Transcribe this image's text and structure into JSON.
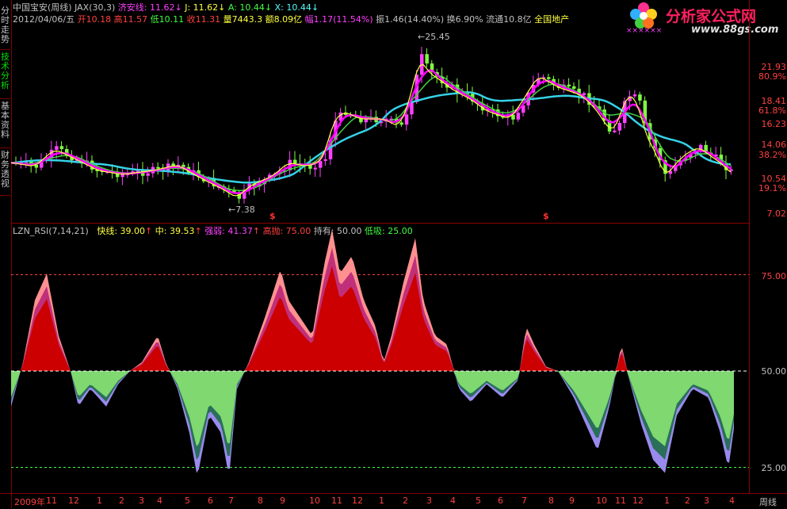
{
  "header": {
    "line1": {
      "stock": "中国宝安(周线)",
      "indicator": "JAX(30,3)",
      "jax_label": "济安线: 11.62",
      "j_label": "J: 11.62",
      "a_label": "A: 10.44",
      "x_label": "X: 10.44"
    },
    "line2": {
      "date": "2012/04/06/五",
      "open": "开10.18",
      "high": "高11.57",
      "low": "低10.11",
      "close": "收11.31",
      "volume": "量7443.3",
      "amount": "额8.09亿",
      "change": "幅1.17(11.54%)",
      "amplitude": "振1.46(14.40%)",
      "turnover": "换6.90%",
      "float": "流通10.8亿",
      "sector": "全国地产"
    }
  },
  "sidebar": {
    "items": [
      {
        "label": "分时走势"
      },
      {
        "label": "技术分析"
      },
      {
        "label": "基本资料"
      },
      {
        "label": "财务透视"
      }
    ]
  },
  "logo": {
    "title": "分析家公式网",
    "url": "www.88gs.com",
    "marks": "××××××"
  },
  "upper_axis": [
    "21.93",
    "80.9%",
    "18.41",
    "61.8%",
    "16.23",
    "14.06",
    "38.2%",
    "10.54",
    "19.1%",
    "7.02"
  ],
  "price_annotations": {
    "high": "25.45",
    "low": "7.38",
    "flag": "$"
  },
  "lower_header": {
    "name": "LZN_RSI(7,14,21)",
    "fast": "快线: 39.00",
    "mid": "中: 39.53",
    "strength": "强弱: 41.37",
    "high_sell": "高抛: 75.00",
    "hold": "持有: 50.00",
    "low_buy": "低吸: 25.00"
  },
  "lower_axis": [
    "75.00",
    "50.00",
    "25.00"
  ],
  "time_axis": {
    "labels": [
      "2009年",
      "11",
      "12",
      "1",
      "2",
      "3",
      "4",
      "5",
      "6",
      "7",
      "8",
      "9",
      "10",
      "11",
      "12",
      "1",
      "2",
      "3",
      "4",
      "5",
      "6",
      "7",
      "8",
      "9",
      "10",
      "11",
      "12",
      "1",
      "2",
      "3",
      "4"
    ],
    "period": "周线"
  },
  "colors": {
    "up": "#ff3232",
    "down": "#54fcfc",
    "rise_fill": "#cc0000",
    "rise_pink": "#ff9090",
    "fall_fill": "#7fd870",
    "fall_purple": "#9a8aee",
    "ma_cyan": "#36d2e6",
    "ma_magenta": "#ff00ff",
    "ma_yellow": "#ffff40",
    "ma_green": "#40d040"
  }
}
